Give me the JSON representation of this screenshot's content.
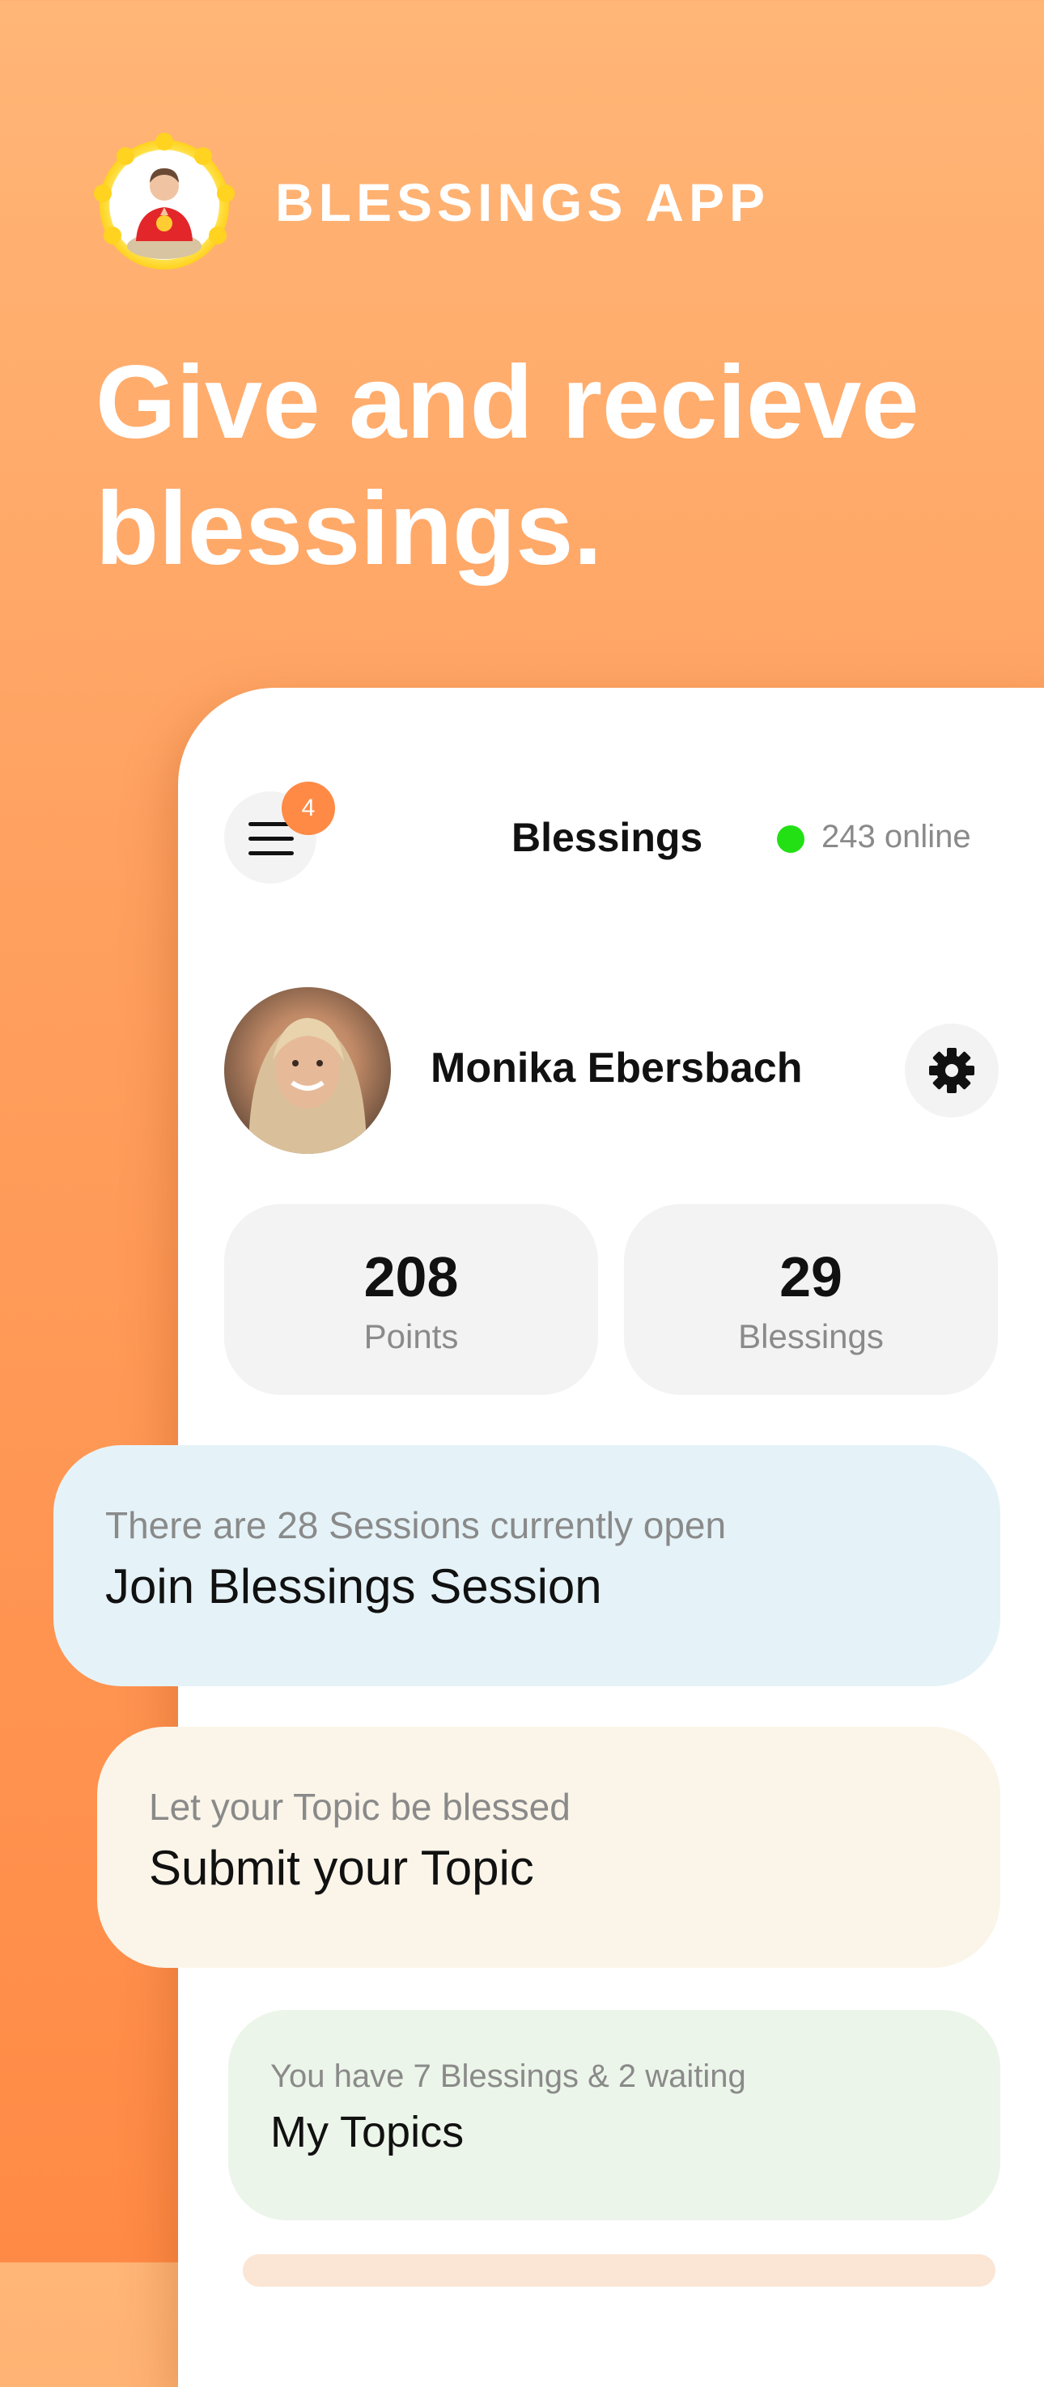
{
  "brand": {
    "name": "BLESSINGS APP",
    "logo_icon": "meditating-person-icon"
  },
  "headline": "Give and recieve blessings.",
  "header": {
    "menu_badge": "4",
    "title": "Blessings",
    "online_text": "243 online",
    "online_color": "#23e014"
  },
  "profile": {
    "name": "Monika Ebersbach",
    "settings_icon": "gear-icon"
  },
  "stats": [
    {
      "value": "208",
      "label": "Points"
    },
    {
      "value": "29",
      "label": "Blessings"
    }
  ],
  "cards": {
    "join": {
      "subtitle": "There are 28 Sessions currently open",
      "title": "Join Blessings Session"
    },
    "submit": {
      "subtitle": "Let your Topic be blessed",
      "title": "Submit your Topic"
    },
    "my_topics": {
      "subtitle": "You have 7 Blessings & 2 waiting",
      "title": "My Topics"
    }
  },
  "colors": {
    "accent": "#ff8a45",
    "join_bg": "#e5f3f8",
    "submit_bg": "#fbf5e9",
    "my_topics_bg": "#ecf5e9"
  }
}
